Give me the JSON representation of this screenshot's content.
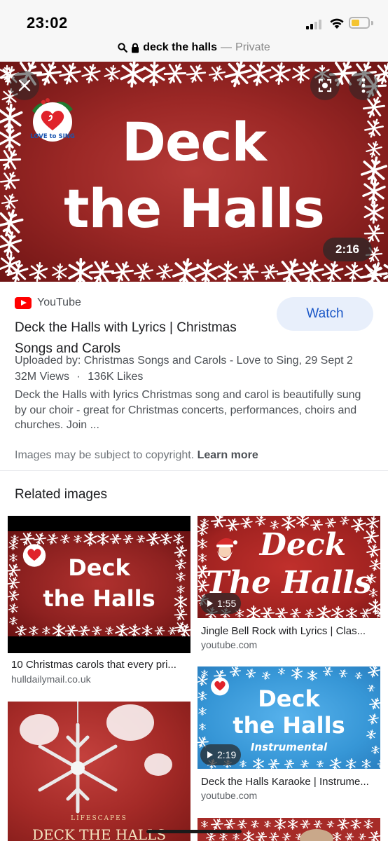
{
  "status_bar": {
    "time": "23:02",
    "battery_level": 0.5,
    "battery_color": "#f4c430"
  },
  "url_bar": {
    "query": "deck the halls",
    "separator": "—",
    "mode": "Private",
    "icons": [
      "search-icon",
      "lock-icon"
    ]
  },
  "hero": {
    "title_line1": "Deck",
    "title_line2": "the Halls",
    "logo_text": "LOVE to SING",
    "duration": "2:16",
    "background_color": "#9c2826",
    "icons": [
      "close-icon",
      "lens-icon",
      "more-vert-icon"
    ]
  },
  "result": {
    "source": "YouTube",
    "watch_label": "Watch",
    "title": "Deck the Halls with Lyrics | Christmas Songs and Carols",
    "uploaded": "Uploaded by: Christmas Songs and Carols - Love to Sing, 29 Sept 2",
    "views": "32M Views",
    "dot": "·",
    "likes": "136K Likes",
    "description": "Deck the Halls with lyrics Christmas song and carol is beautifully sung by our choir - great for Christmas concerts, performances, choirs and churches. Join ...",
    "copyright_text": "Images may be subject to copyright.",
    "learn_more": "Learn more",
    "accent_color": "#1a57c7"
  },
  "related": {
    "heading": "Related images",
    "items": [
      {
        "thumb_line1": "Deck",
        "thumb_line2": "the Halls",
        "title": "10 Christmas carols that every pri...",
        "site": "hulldailymail.co.uk"
      },
      {
        "thumb_line1": "Deck",
        "thumb_line2": "The Halls",
        "duration": "1:55",
        "title": "Jingle Bell Rock with Lyrics | Clas...",
        "site": "youtube.com"
      },
      {
        "thumb_line1": "Deck",
        "thumb_line2": "the Halls",
        "thumb_line3": "Instrumental",
        "duration": "2:19",
        "title": "Deck the Halls Karaoke | Instrume...",
        "site": "youtube.com"
      },
      {
        "thumb_brand": "LIFESCAPES",
        "thumb_line1": "DECK THE HALLS"
      }
    ]
  }
}
